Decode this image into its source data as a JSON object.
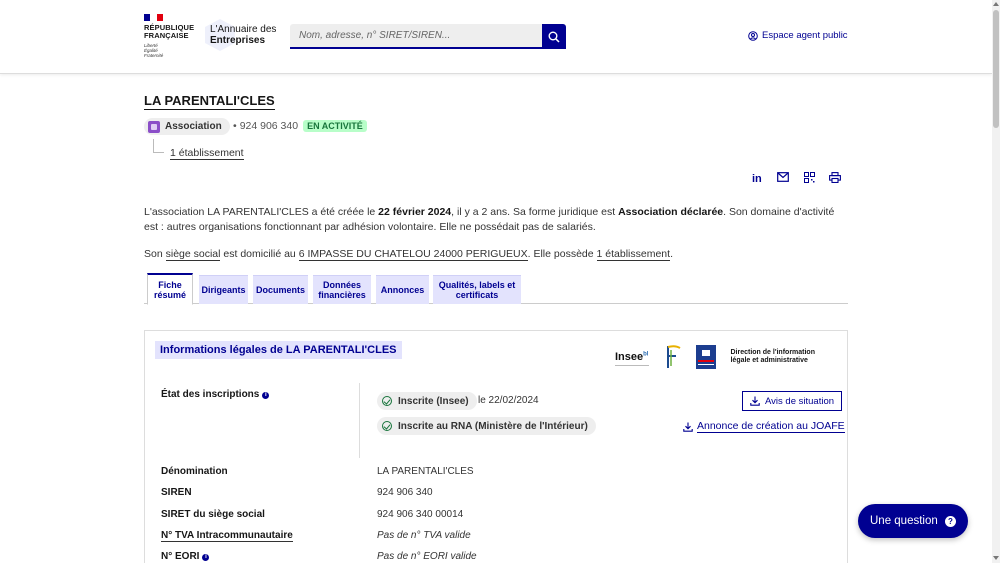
{
  "header": {
    "rf_title_line1": "RÉPUBLIQUE",
    "rf_title_line2": "FRANÇAISE",
    "rf_motto1": "Liberté",
    "rf_motto2": "Égalité",
    "rf_motto3": "Fraternité",
    "site_line1": "L'Annuaire des",
    "site_line2": "Entreprises",
    "search_placeholder": "Nom, adresse, n° SIRET/SIREN...",
    "agent_link": "Espace agent public",
    "colors": {
      "primary": "#000091",
      "flag_blue": "#000091",
      "flag_red": "#e1000f"
    }
  },
  "company": {
    "name": "LA PARENTALI'CLES",
    "type_badge": "Association",
    "siren": "924 906 340",
    "status": "EN ACTIVITÉ",
    "status_color": "#18753c",
    "establishments_link": "1 établissement"
  },
  "share_icons": [
    "linkedin-icon",
    "mail-icon",
    "qrcode-icon",
    "print-icon"
  ],
  "description": {
    "p1_a": "L'association LA PARENTALI'CLES a été créée le ",
    "p1_date": "22 février 2024",
    "p1_b": ", il y a 2 ans. Sa forme juridique est ",
    "p1_form": "Association déclarée",
    "p1_c": ". Son domaine d'activité est : autres organisations fonctionnant par adhésion volontaire. Elle ne possédait pas de salariés.",
    "p2_a": "Son ",
    "p2_siege": "siège social",
    "p2_b": " est domicilié au ",
    "p2_address": "6 IMPASSE DU CHATELOU 24000 PERIGUEUX",
    "p2_c": ". Elle possède ",
    "p2_etab": "1 établissement",
    "p2_d": "."
  },
  "tabs": [
    {
      "line1": "Fiche",
      "line2": "résumé",
      "active": true
    },
    {
      "line1": "Dirigeants",
      "line2": "",
      "active": false
    },
    {
      "line1": "Documents",
      "line2": "",
      "active": false
    },
    {
      "line1": "Données",
      "line2": "financières",
      "active": false
    },
    {
      "line1": "Annonces",
      "line2": "",
      "active": false
    },
    {
      "line1": "Qualités, labels et",
      "line2": "certificats",
      "active": false
    }
  ],
  "panel": {
    "title": "Informations légales de LA PARENTALI'CLES",
    "partner_insee": "Insee",
    "partner_insee_sup": "bl",
    "partner_dila": "Direction de l'information légale et administrative",
    "etat_label": "État des inscriptions",
    "inscription_insee": "Inscrite (Insee)",
    "inscription_insee_date": "le 22/02/2024",
    "inscription_rna": "Inscrite au RNA (Ministère de l'Intérieur)",
    "avis_button": "Avis de situation",
    "joafe_link": "Annonce de création au JOAFE",
    "rows": [
      {
        "label": "Dénomination",
        "value": "LA PARENTALI'CLES"
      },
      {
        "label": "SIREN",
        "value": "924 906 340"
      },
      {
        "label": "SIRET du siège social",
        "value": "924 906 340 00014"
      },
      {
        "label": "N° TVA Intracommunautaire",
        "value": "Pas de n° TVA valide"
      },
      {
        "label": "N° EORI",
        "value": "Pas de n° EORI valide"
      }
    ]
  },
  "question_button": "Une question"
}
